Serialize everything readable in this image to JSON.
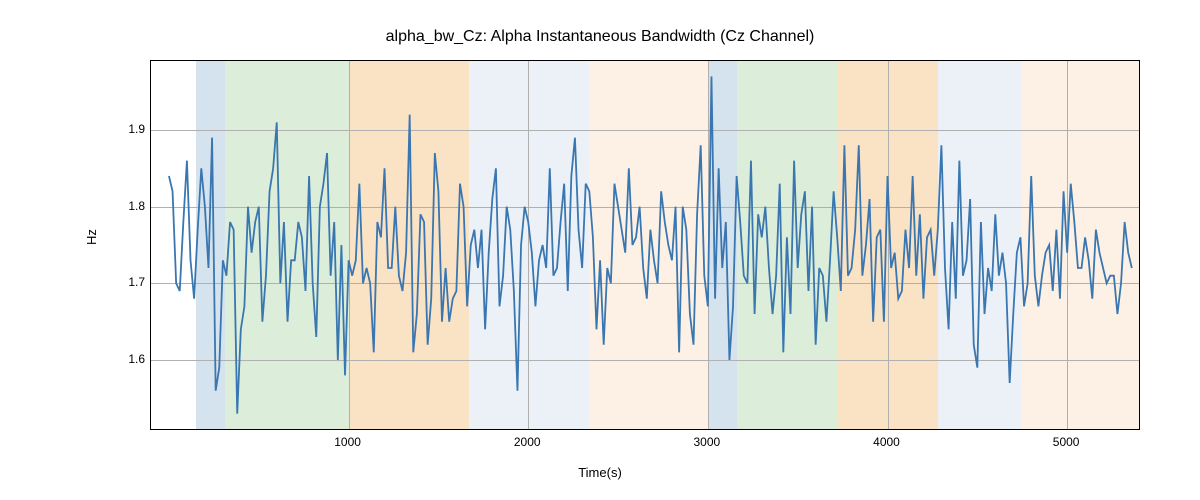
{
  "chart_data": {
    "type": "line",
    "title": "alpha_bw_Cz: Alpha Instantaneous Bandwidth (Cz Channel)",
    "xlabel": "Time(s)",
    "ylabel": "Hz",
    "xlim": [
      -100,
      5400
    ],
    "ylim": [
      1.51,
      1.99
    ],
    "xticks": [
      1000,
      2000,
      3000,
      4000,
      5000
    ],
    "yticks": [
      1.6,
      1.7,
      1.8,
      1.9
    ],
    "grid": true,
    "background_bands": [
      {
        "x0": 150,
        "x1": 310,
        "color": "#b9d1e4",
        "alpha": 0.6
      },
      {
        "x0": 310,
        "x1": 1000,
        "color": "#c5e3c1",
        "alpha": 0.6
      },
      {
        "x0": 1000,
        "x1": 1670,
        "color": "#f7ce9e",
        "alpha": 0.6
      },
      {
        "x0": 1670,
        "x1": 2340,
        "color": "#dde7f2",
        "alpha": 0.6
      },
      {
        "x0": 2340,
        "x1": 3000,
        "color": "#fbe8d3",
        "alpha": 0.6
      },
      {
        "x0": 3000,
        "x1": 3160,
        "color": "#b9d1e4",
        "alpha": 0.6
      },
      {
        "x0": 3160,
        "x1": 3720,
        "color": "#c5e3c1",
        "alpha": 0.6
      },
      {
        "x0": 3720,
        "x1": 4280,
        "color": "#f7ce9e",
        "alpha": 0.6
      },
      {
        "x0": 4280,
        "x1": 4750,
        "color": "#dde7f2",
        "alpha": 0.6
      },
      {
        "x0": 4750,
        "x1": 5400,
        "color": "#fbe8d3",
        "alpha": 0.6
      }
    ],
    "line_color": "#3a76af",
    "x": [
      0,
      20,
      40,
      60,
      80,
      100,
      120,
      140,
      160,
      180,
      200,
      220,
      240,
      260,
      280,
      300,
      320,
      340,
      360,
      380,
      400,
      420,
      440,
      460,
      480,
      500,
      520,
      540,
      560,
      580,
      600,
      620,
      640,
      660,
      680,
      700,
      720,
      740,
      760,
      780,
      800,
      820,
      840,
      860,
      880,
      900,
      920,
      940,
      960,
      980,
      1000,
      1020,
      1040,
      1060,
      1080,
      1100,
      1120,
      1140,
      1160,
      1180,
      1200,
      1220,
      1240,
      1260,
      1280,
      1300,
      1320,
      1340,
      1360,
      1380,
      1400,
      1420,
      1440,
      1460,
      1480,
      1500,
      1520,
      1540,
      1560,
      1580,
      1600,
      1620,
      1640,
      1660,
      1680,
      1700,
      1720,
      1740,
      1760,
      1780,
      1800,
      1820,
      1840,
      1860,
      1880,
      1900,
      1920,
      1940,
      1960,
      1980,
      2000,
      2020,
      2040,
      2060,
      2080,
      2100,
      2120,
      2140,
      2160,
      2180,
      2200,
      2220,
      2240,
      2260,
      2280,
      2300,
      2320,
      2340,
      2360,
      2380,
      2400,
      2420,
      2440,
      2460,
      2480,
      2500,
      2520,
      2540,
      2560,
      2580,
      2600,
      2620,
      2640,
      2660,
      2680,
      2700,
      2720,
      2740,
      2760,
      2780,
      2800,
      2820,
      2840,
      2860,
      2880,
      2900,
      2920,
      2940,
      2960,
      2980,
      3000,
      3020,
      3040,
      3060,
      3080,
      3100,
      3120,
      3140,
      3160,
      3180,
      3200,
      3220,
      3240,
      3260,
      3280,
      3300,
      3320,
      3340,
      3360,
      3380,
      3400,
      3420,
      3440,
      3460,
      3480,
      3500,
      3520,
      3540,
      3560,
      3580,
      3600,
      3620,
      3640,
      3660,
      3680,
      3700,
      3720,
      3740,
      3760,
      3780,
      3800,
      3820,
      3840,
      3860,
      3880,
      3900,
      3920,
      3940,
      3960,
      3980,
      4000,
      4020,
      4040,
      4060,
      4080,
      4100,
      4120,
      4140,
      4160,
      4180,
      4200,
      4220,
      4240,
      4260,
      4280,
      4300,
      4320,
      4340,
      4360,
      4380,
      4400,
      4420,
      4440,
      4460,
      4480,
      4500,
      4520,
      4540,
      4560,
      4580,
      4600,
      4620,
      4640,
      4660,
      4680,
      4700,
      4720,
      4740,
      4760,
      4780,
      4800,
      4820,
      4840,
      4860,
      4880,
      4900,
      4920,
      4940,
      4960,
      4980,
      5000,
      5020,
      5040,
      5060,
      5080,
      5100,
      5120,
      5140,
      5160,
      5180,
      5200,
      5220,
      5240,
      5260,
      5280,
      5300,
      5320,
      5340,
      5360
    ],
    "y": [
      1.84,
      1.82,
      1.7,
      1.69,
      1.78,
      1.86,
      1.73,
      1.68,
      1.77,
      1.85,
      1.8,
      1.72,
      1.89,
      1.56,
      1.59,
      1.73,
      1.71,
      1.78,
      1.77,
      1.53,
      1.64,
      1.67,
      1.8,
      1.74,
      1.78,
      1.8,
      1.65,
      1.71,
      1.82,
      1.85,
      1.91,
      1.7,
      1.78,
      1.65,
      1.73,
      1.73,
      1.78,
      1.76,
      1.69,
      1.84,
      1.7,
      1.63,
      1.8,
      1.83,
      1.87,
      1.71,
      1.78,
      1.6,
      1.75,
      1.58,
      1.73,
      1.71,
      1.73,
      1.83,
      1.7,
      1.72,
      1.7,
      1.61,
      1.78,
      1.76,
      1.85,
      1.72,
      1.72,
      1.8,
      1.71,
      1.69,
      1.74,
      1.92,
      1.61,
      1.66,
      1.79,
      1.78,
      1.62,
      1.68,
      1.87,
      1.82,
      1.65,
      1.72,
      1.65,
      1.68,
      1.69,
      1.83,
      1.8,
      1.67,
      1.75,
      1.77,
      1.72,
      1.77,
      1.64,
      1.74,
      1.81,
      1.85,
      1.67,
      1.71,
      1.8,
      1.77,
      1.69,
      1.56,
      1.75,
      1.8,
      1.78,
      1.74,
      1.67,
      1.73,
      1.75,
      1.72,
      1.85,
      1.71,
      1.72,
      1.78,
      1.83,
      1.69,
      1.84,
      1.89,
      1.77,
      1.72,
      1.83,
      1.82,
      1.76,
      1.64,
      1.73,
      1.62,
      1.72,
      1.7,
      1.83,
      1.8,
      1.77,
      1.74,
      1.85,
      1.75,
      1.76,
      1.8,
      1.72,
      1.68,
      1.77,
      1.73,
      1.7,
      1.82,
      1.78,
      1.75,
      1.73,
      1.8,
      1.61,
      1.8,
      1.77,
      1.66,
      1.62,
      1.79,
      1.88,
      1.71,
      1.67,
      1.97,
      1.68,
      1.85,
      1.72,
      1.78,
      1.6,
      1.67,
      1.84,
      1.78,
      1.71,
      1.7,
      1.86,
      1.66,
      1.79,
      1.76,
      1.8,
      1.72,
      1.66,
      1.71,
      1.83,
      1.61,
      1.76,
      1.66,
      1.86,
      1.72,
      1.79,
      1.82,
      1.69,
      1.8,
      1.62,
      1.72,
      1.71,
      1.65,
      1.73,
      1.82,
      1.76,
      1.69,
      1.88,
      1.71,
      1.72,
      1.77,
      1.88,
      1.71,
      1.75,
      1.81,
      1.65,
      1.76,
      1.77,
      1.65,
      1.84,
      1.72,
      1.74,
      1.68,
      1.69,
      1.77,
      1.72,
      1.84,
      1.71,
      1.79,
      1.68,
      1.76,
      1.77,
      1.71,
      1.77,
      1.88,
      1.72,
      1.64,
      1.78,
      1.68,
      1.86,
      1.71,
      1.73,
      1.81,
      1.62,
      1.59,
      1.78,
      1.66,
      1.72,
      1.69,
      1.79,
      1.71,
      1.74,
      1.7,
      1.57,
      1.66,
      1.74,
      1.76,
      1.67,
      1.7,
      1.84,
      1.71,
      1.67,
      1.71,
      1.74,
      1.75,
      1.69,
      1.77,
      1.68,
      1.82,
      1.74,
      1.83,
      1.78,
      1.72,
      1.72,
      1.76,
      1.73,
      1.68,
      1.77,
      1.74,
      1.72,
      1.7,
      1.71,
      1.71,
      1.66,
      1.7,
      1.78,
      1.74,
      1.72
    ]
  }
}
